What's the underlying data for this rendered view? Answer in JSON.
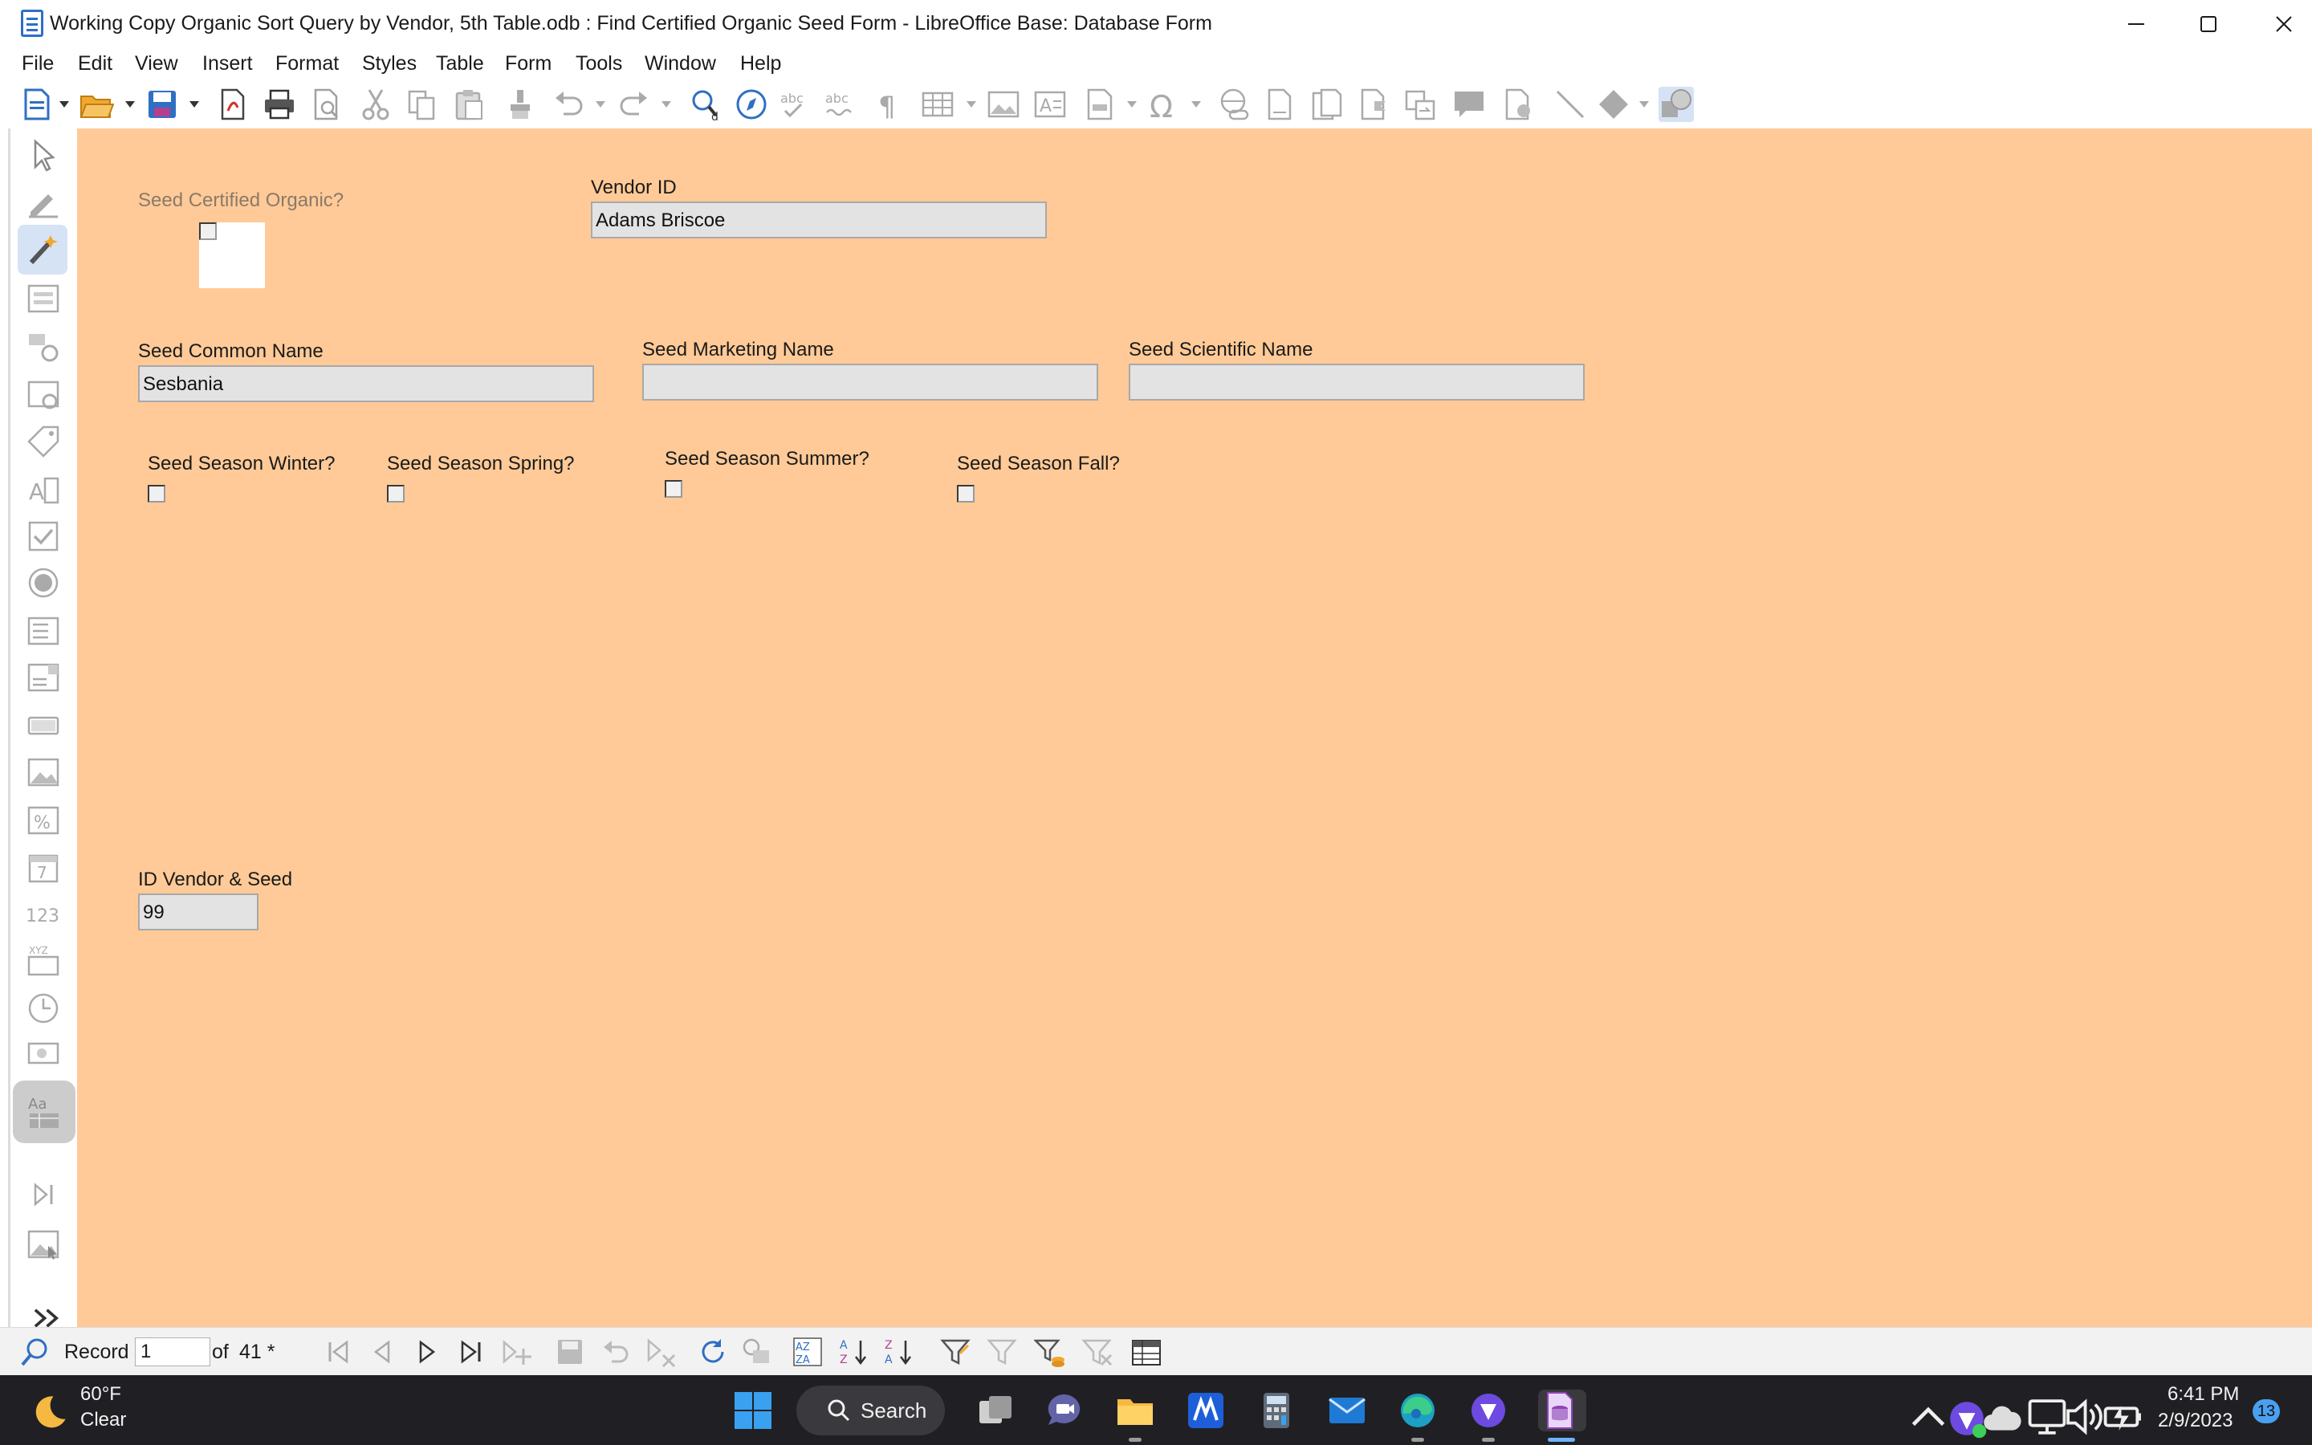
{
  "window": {
    "title": "Working Copy Organic Sort Query by Vendor, 5th Table.odb : Find Certified Organic Seed Form - LibreOffice Base: Database Form",
    "minimize_icon": "minimize-icon",
    "maximize_icon": "maximize-icon",
    "close_icon": "close-icon"
  },
  "menu": {
    "items": [
      "File",
      "Edit",
      "View",
      "Insert",
      "Format",
      "Styles",
      "Table",
      "Form",
      "Tools",
      "Window",
      "Help"
    ]
  },
  "form": {
    "seed_certified_organic_label": "Seed Certified Organic?",
    "vendor_id_label": "Vendor ID",
    "vendor_id_value": "Adams Briscoe",
    "seed_common_name_label": "Seed Common Name",
    "seed_common_name_value": "Sesbania",
    "seed_marketing_name_label": "Seed Marketing Name",
    "seed_marketing_name_value": "",
    "seed_scientific_name_label": "Seed Scientific Name",
    "seed_scientific_name_value": "",
    "season_winter_label": "Seed Season Winter?",
    "season_spring_label": "Seed Season Spring?",
    "season_summer_label": "Seed Season Summer?",
    "season_fall_label": "Seed Season Fall?",
    "id_vendor_seed_label": "ID Vendor & Seed",
    "id_vendor_seed_value": "99",
    "background_color": "#ffca97"
  },
  "record_bar": {
    "record_label": "Record",
    "record_value": "1",
    "of_label": "of",
    "total": "41 *"
  },
  "taskbar": {
    "weather_temp": "60°F",
    "weather_desc": "Clear",
    "search_label": "Search",
    "time": "6:41 PM",
    "date": "2/9/2023",
    "notification_count": "13"
  }
}
